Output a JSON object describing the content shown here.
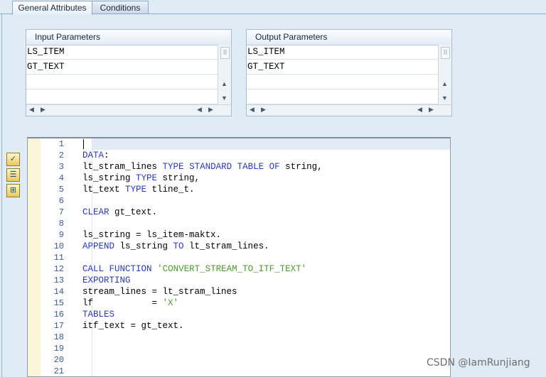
{
  "tabs": [
    {
      "label": "General Attributes",
      "active": true
    },
    {
      "label": "Conditions",
      "active": false
    }
  ],
  "input_parameters": {
    "header": "Input Parameters",
    "rows": [
      "LS_ITEM",
      "GT_TEXT",
      "",
      ""
    ]
  },
  "output_parameters": {
    "header": "Output Parameters",
    "rows": [
      "LS_ITEM",
      "GT_TEXT",
      "",
      ""
    ]
  },
  "sidebar_icons": [
    "check-icon",
    "display-icon",
    "structure-icon"
  ],
  "code_lines": [
    {
      "n": "1",
      "code": ""
    },
    {
      "n": "2",
      "code": "DATA:"
    },
    {
      "n": "3",
      "code": "lt_stram_lines TYPE STANDARD TABLE OF string,"
    },
    {
      "n": "4",
      "code": "ls_string TYPE string,"
    },
    {
      "n": "5",
      "code": "lt_text TYPE tline_t."
    },
    {
      "n": "6",
      "code": ""
    },
    {
      "n": "7",
      "code": "CLEAR gt_text."
    },
    {
      "n": "8",
      "code": ""
    },
    {
      "n": "9",
      "code": "ls_string = ls_item-maktx."
    },
    {
      "n": "10",
      "code": "APPEND ls_string TO lt_stram_lines."
    },
    {
      "n": "11",
      "code": ""
    },
    {
      "n": "12",
      "code": "CALL FUNCTION 'CONVERT_STREAM_TO_ITF_TEXT'"
    },
    {
      "n": "13",
      "code": "EXPORTING"
    },
    {
      "n": "14",
      "code": "stream_lines = lt_stram_lines"
    },
    {
      "n": "15",
      "code": "lf           = 'X'"
    },
    {
      "n": "16",
      "code": "TABLES"
    },
    {
      "n": "17",
      "code": "itf_text = gt_text."
    },
    {
      "n": "18",
      "code": ""
    },
    {
      "n": "19",
      "code": ""
    },
    {
      "n": "20",
      "code": ""
    },
    {
      "n": "21",
      "code": ""
    }
  ],
  "watermark": "CSDN @IamRunjiang",
  "colors": {
    "keyword": "#2a38c8",
    "string_literal": "#4c9a2a",
    "line_number": "#3a5a96"
  }
}
